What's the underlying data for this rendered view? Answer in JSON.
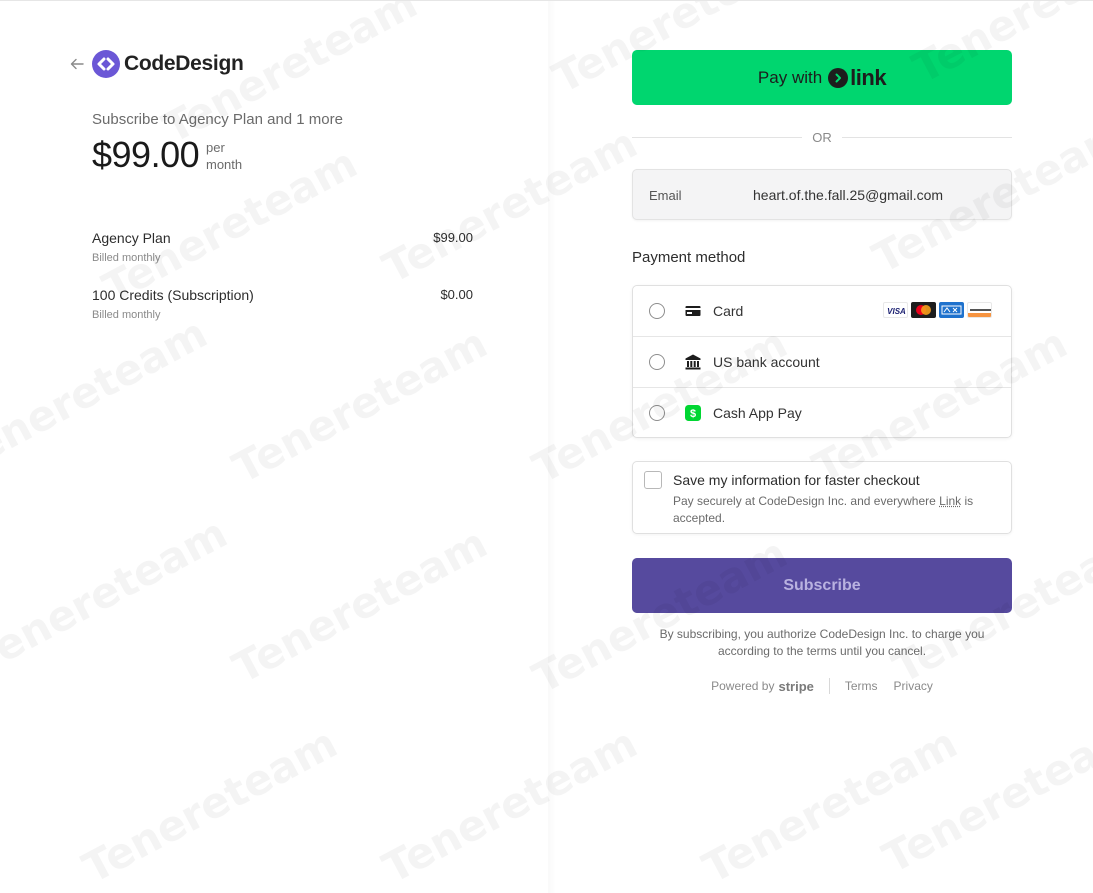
{
  "header": {
    "back_icon": "arrow-left-icon",
    "logo_name": "CodeDesign",
    "brand_color": "#6b57d6"
  },
  "summary": {
    "title": "Subscribe to Agency Plan and 1 more",
    "price": "$99.00",
    "period_line1": "per",
    "period_line2": "month"
  },
  "line_items": [
    {
      "name": "Agency Plan",
      "billing": "Billed monthly",
      "amount": "$99.00"
    },
    {
      "name": "100 Credits (Subscription)",
      "billing": "Billed monthly",
      "amount": "$0.00"
    }
  ],
  "link_button": {
    "prefix": "Pay with",
    "brand": "link",
    "color": "#00d66f"
  },
  "divider_text": "OR",
  "email": {
    "label": "Email",
    "value": "heart.of.the.fall.25@gmail.com"
  },
  "payment_method": {
    "title": "Payment method",
    "options": [
      {
        "label": "Card",
        "icon": "credit-card-icon",
        "selected": false
      },
      {
        "label": "US bank account",
        "icon": "bank-icon",
        "selected": false
      },
      {
        "label": "Cash App Pay",
        "icon": "cash-app-icon",
        "selected": false
      }
    ],
    "card_brands": [
      "VISA",
      "Mastercard",
      "AMEX",
      "DISCOVER"
    ]
  },
  "save_info": {
    "title": "Save my information for faster checkout",
    "desc_before": "Pay securely at CodeDesign Inc. and everywhere ",
    "desc_link": "Link",
    "desc_after": " is accepted.",
    "checked": false
  },
  "subscribe_button": {
    "label": "Subscribe",
    "color": "#564a9e"
  },
  "legal_text": "By subscribing, you authorize CodeDesign Inc. to charge you according to the terms until you cancel.",
  "footer": {
    "powered_by": "Powered by",
    "stripe": "stripe",
    "terms": "Terms",
    "privacy": "Privacy"
  },
  "watermark": "Tenereteam"
}
